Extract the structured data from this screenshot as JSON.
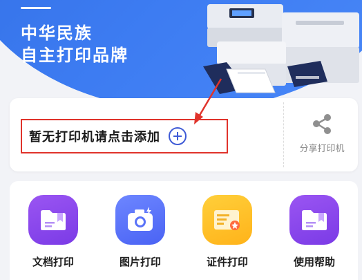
{
  "hero": {
    "title_line1": "中华民族",
    "title_line2": "自主打印品牌"
  },
  "printer_card": {
    "add_label": "暂无打印机请点击添加",
    "share_label": "分享打印机"
  },
  "functions": [
    {
      "label": "文档打印",
      "icon": "folder-icon",
      "color": "#8e48ef"
    },
    {
      "label": "图片打印",
      "icon": "camera-icon",
      "color": "#5a73f8"
    },
    {
      "label": "证件打印",
      "icon": "id-card-icon",
      "color": "#ffbf25"
    },
    {
      "label": "使用帮助",
      "icon": "folder-icon",
      "color": "#8e48ef"
    }
  ],
  "colors": {
    "hero_blue": "#3d7cf2",
    "highlight_red": "#e0332b",
    "plus_blue": "#3f5bd6"
  }
}
